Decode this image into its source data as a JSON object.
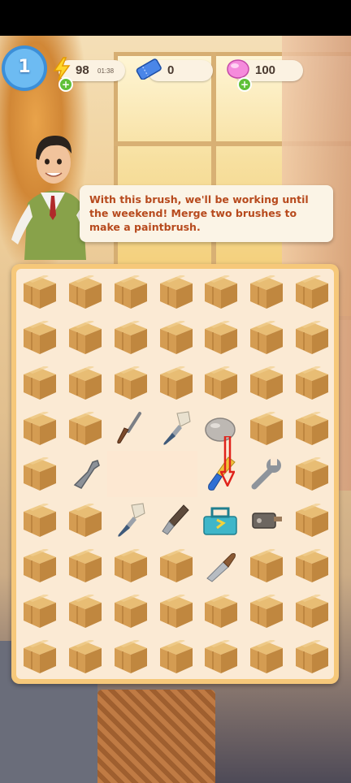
{
  "header": {
    "level": "1",
    "energy": {
      "value": "98",
      "timer": "01:38",
      "icon": "lightning-icon"
    },
    "tickets": {
      "value": "0",
      "icon": "ticket-icon"
    },
    "gems": {
      "value": "100",
      "icon": "gem-icon"
    }
  },
  "dialog": {
    "text": "With this brush, we'll be working until the weekend! Merge two brushes to make a paintbrush."
  },
  "board": {
    "rows": 9,
    "cols": 7,
    "cells": [
      [
        "box",
        "box",
        "box",
        "box",
        "box",
        "box",
        "box"
      ],
      [
        "box",
        "box",
        "box",
        "box",
        "box",
        "box",
        "box"
      ],
      [
        "box",
        "box",
        "box",
        "box",
        "box",
        "box",
        "box"
      ],
      [
        "box",
        "box",
        "screwdriver",
        "brush",
        "stone",
        "box",
        "box"
      ],
      [
        "box",
        "wrench-broken",
        "empty",
        "empty",
        "paintbrush",
        "wrench",
        "box"
      ],
      [
        "box",
        "box",
        "brush",
        "chisel",
        "toolbox",
        "clamp",
        "box"
      ],
      [
        "box",
        "box",
        "box",
        "box",
        "knife",
        "box",
        "box"
      ],
      [
        "box",
        "box",
        "box",
        "box",
        "box",
        "box",
        "box"
      ],
      [
        "box",
        "box",
        "box",
        "box",
        "box",
        "box",
        "box"
      ]
    ]
  },
  "colors": {
    "board_border": "#f6c87a",
    "speech_text": "#b74a1d",
    "hint_arrow": "#e0231b"
  }
}
